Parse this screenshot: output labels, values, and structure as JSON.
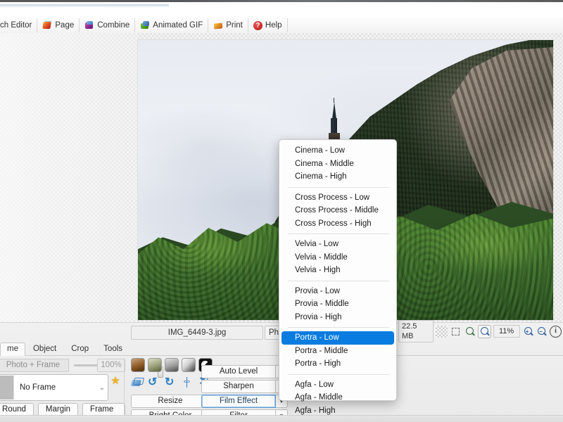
{
  "menubar": {
    "items": [
      {
        "label": "ch Editor",
        "icon": "batch-editor-icon",
        "clipped": true
      },
      {
        "label": "Page",
        "icon": "page-icon",
        "clipped": false
      },
      {
        "label": "Combine",
        "icon": "combine-icon",
        "clipped": false
      },
      {
        "label": "Animated GIF",
        "icon": "animated-gif-icon",
        "clipped": false
      },
      {
        "label": "Print",
        "icon": "print-icon",
        "clipped": false
      },
      {
        "label": "Help",
        "icon": "help-icon",
        "clipped": false
      }
    ]
  },
  "filebar": {
    "filename": "IMG_6449-3.jpg",
    "photo_button": "Pho"
  },
  "statusbar": {
    "file_size": "22.5 MB",
    "zoom_level": "11%",
    "icons": [
      "transparency-icon",
      "fit-expand-icon",
      "zoom-actual-icon",
      "zoom-fit-icon",
      "zoom-in-icon",
      "zoom-out-icon",
      "info-icon"
    ]
  },
  "tabs": [
    {
      "label": "me",
      "active": true
    },
    {
      "label": "Object",
      "active": false
    },
    {
      "label": "Crop",
      "active": false
    },
    {
      "label": "Tools",
      "active": false
    }
  ],
  "frame_panel": {
    "mode_label": "Photo + Frame",
    "zoom_percent": "100%",
    "frame_select_value": "No Frame",
    "buttons": [
      "Round",
      "Margin",
      "Frame Line"
    ]
  },
  "adjust_panel": {
    "swatches": [
      "sepia-swatch",
      "olive-swatch",
      "grey-swatch",
      "gradient-swatch",
      "bw-swatch"
    ],
    "tools": [
      "stack-icon",
      "undo-icon",
      "redo-icon",
      "flip-horizontal-icon",
      "flip-vertical-icon"
    ],
    "buttons": [
      {
        "label": "Resize",
        "focused": false
      },
      {
        "label": "Auto Level",
        "focused": false
      },
      {
        "label": "Bright,Color",
        "focused": false
      },
      {
        "label": "Sharpen",
        "focused": false
      },
      {
        "label": "Film Effect",
        "focused": true
      },
      {
        "label": "Filter",
        "focused": false
      }
    ]
  },
  "film_effect_menu": {
    "selected": "Portra - Low",
    "groups": [
      [
        "Cinema - Low",
        "Cinema - Middle",
        "Cinema - High"
      ],
      [
        "Cross Process - Low",
        "Cross Process - Middle",
        "Cross Process - High"
      ],
      [
        "Velvia - Low",
        "Velvia - Middle",
        "Velvia - High"
      ],
      [
        "Provia - Low",
        "Provia - Middle",
        "Provia - High"
      ],
      [
        "Portra - Low",
        "Portra - Middle",
        "Portra - High"
      ],
      [
        "Agfa - Low",
        "Agfa - Middle",
        "Agfa - High"
      ]
    ]
  },
  "colors": {
    "accent": "#0a7ce0",
    "focus_border": "#5b9bd5",
    "panel_bg": "#eaeaea"
  }
}
